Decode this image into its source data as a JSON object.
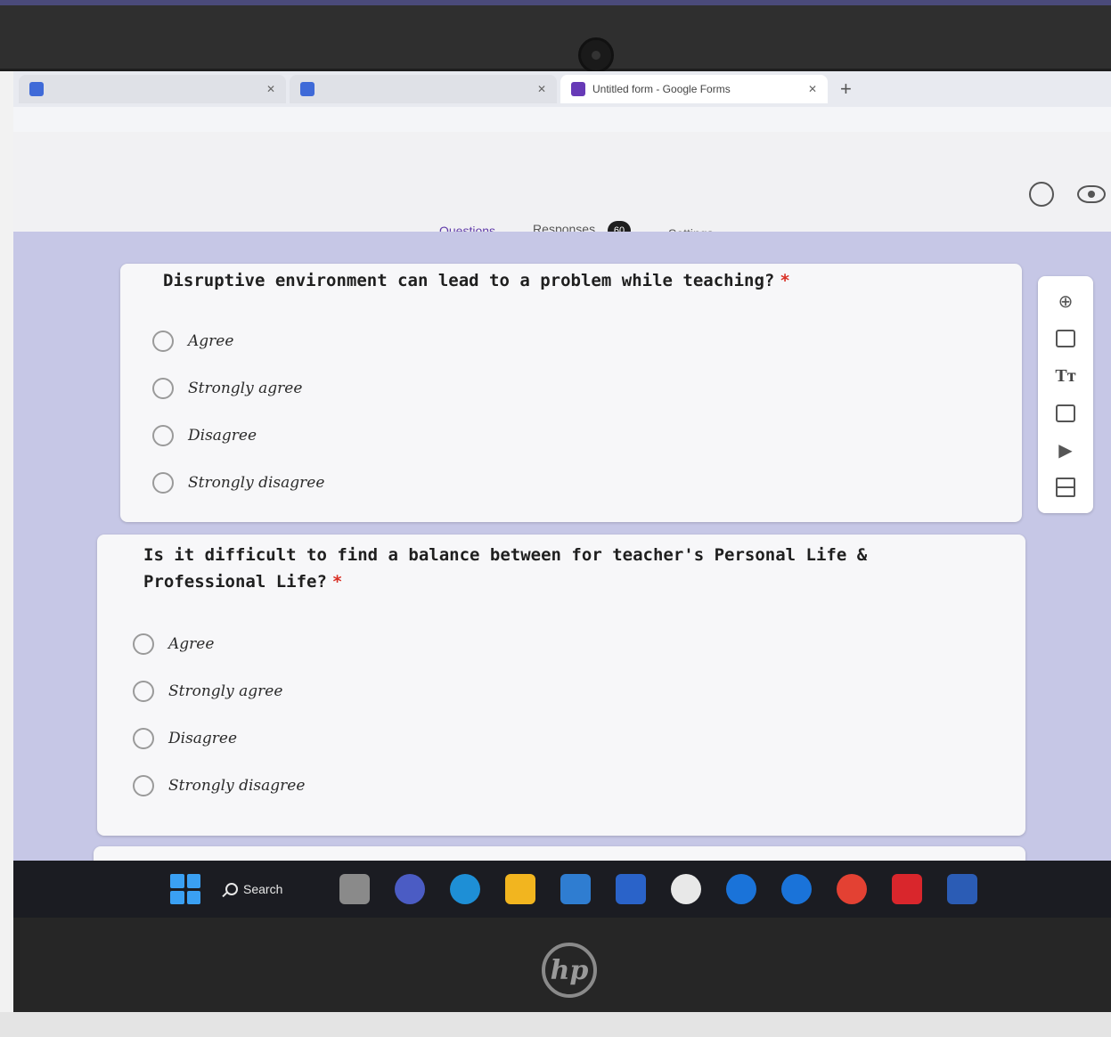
{
  "browser": {
    "tabs": [
      {
        "title": "",
        "active": false
      },
      {
        "title": "",
        "active": false
      },
      {
        "title": "Untitled form - Google Forms",
        "active": true
      }
    ],
    "new_tab": "+",
    "url": ""
  },
  "form": {
    "tabs": [
      {
        "label": "Questions",
        "active": true
      },
      {
        "label": "Responses",
        "active": false,
        "badge": "60"
      },
      {
        "label": "Settings",
        "active": false
      }
    ],
    "questions": [
      {
        "title": "Disruptive environment can lead to a problem while teaching?",
        "required_mark": "*",
        "options": [
          "Agree",
          "Strongly agree",
          "Disagree",
          "Strongly disagree"
        ]
      },
      {
        "title": "Is it difficult to find a balance between for teacher's Personal Life & Professional Life?",
        "required_mark": "*",
        "options": [
          "Agree",
          "Strongly agree",
          "Disagree",
          "Strongly disagree"
        ]
      }
    ],
    "toolbar": {
      "add_question": "add-question-icon",
      "import_questions": "import-questions-icon",
      "add_title": "Tт",
      "add_image": "add-image-icon",
      "add_video": "add-video-icon",
      "add_section": "add-section-icon"
    }
  },
  "taskbar": {
    "search_label": "Search",
    "apps": [
      "file-explorer-icon",
      "teams-icon",
      "edge-icon",
      "folder-icon",
      "mail-icon",
      "store-icon",
      "camera-icon",
      "app-icon-1",
      "app-icon-2",
      "chrome-icon",
      "app-icon-3",
      "word-icon"
    ]
  },
  "device": {
    "brand": "hp"
  },
  "colors": {
    "accent": "#673ab7",
    "canvas": "#c6c7e6",
    "required": "#d93025",
    "taskbar": "#1b1c22"
  }
}
